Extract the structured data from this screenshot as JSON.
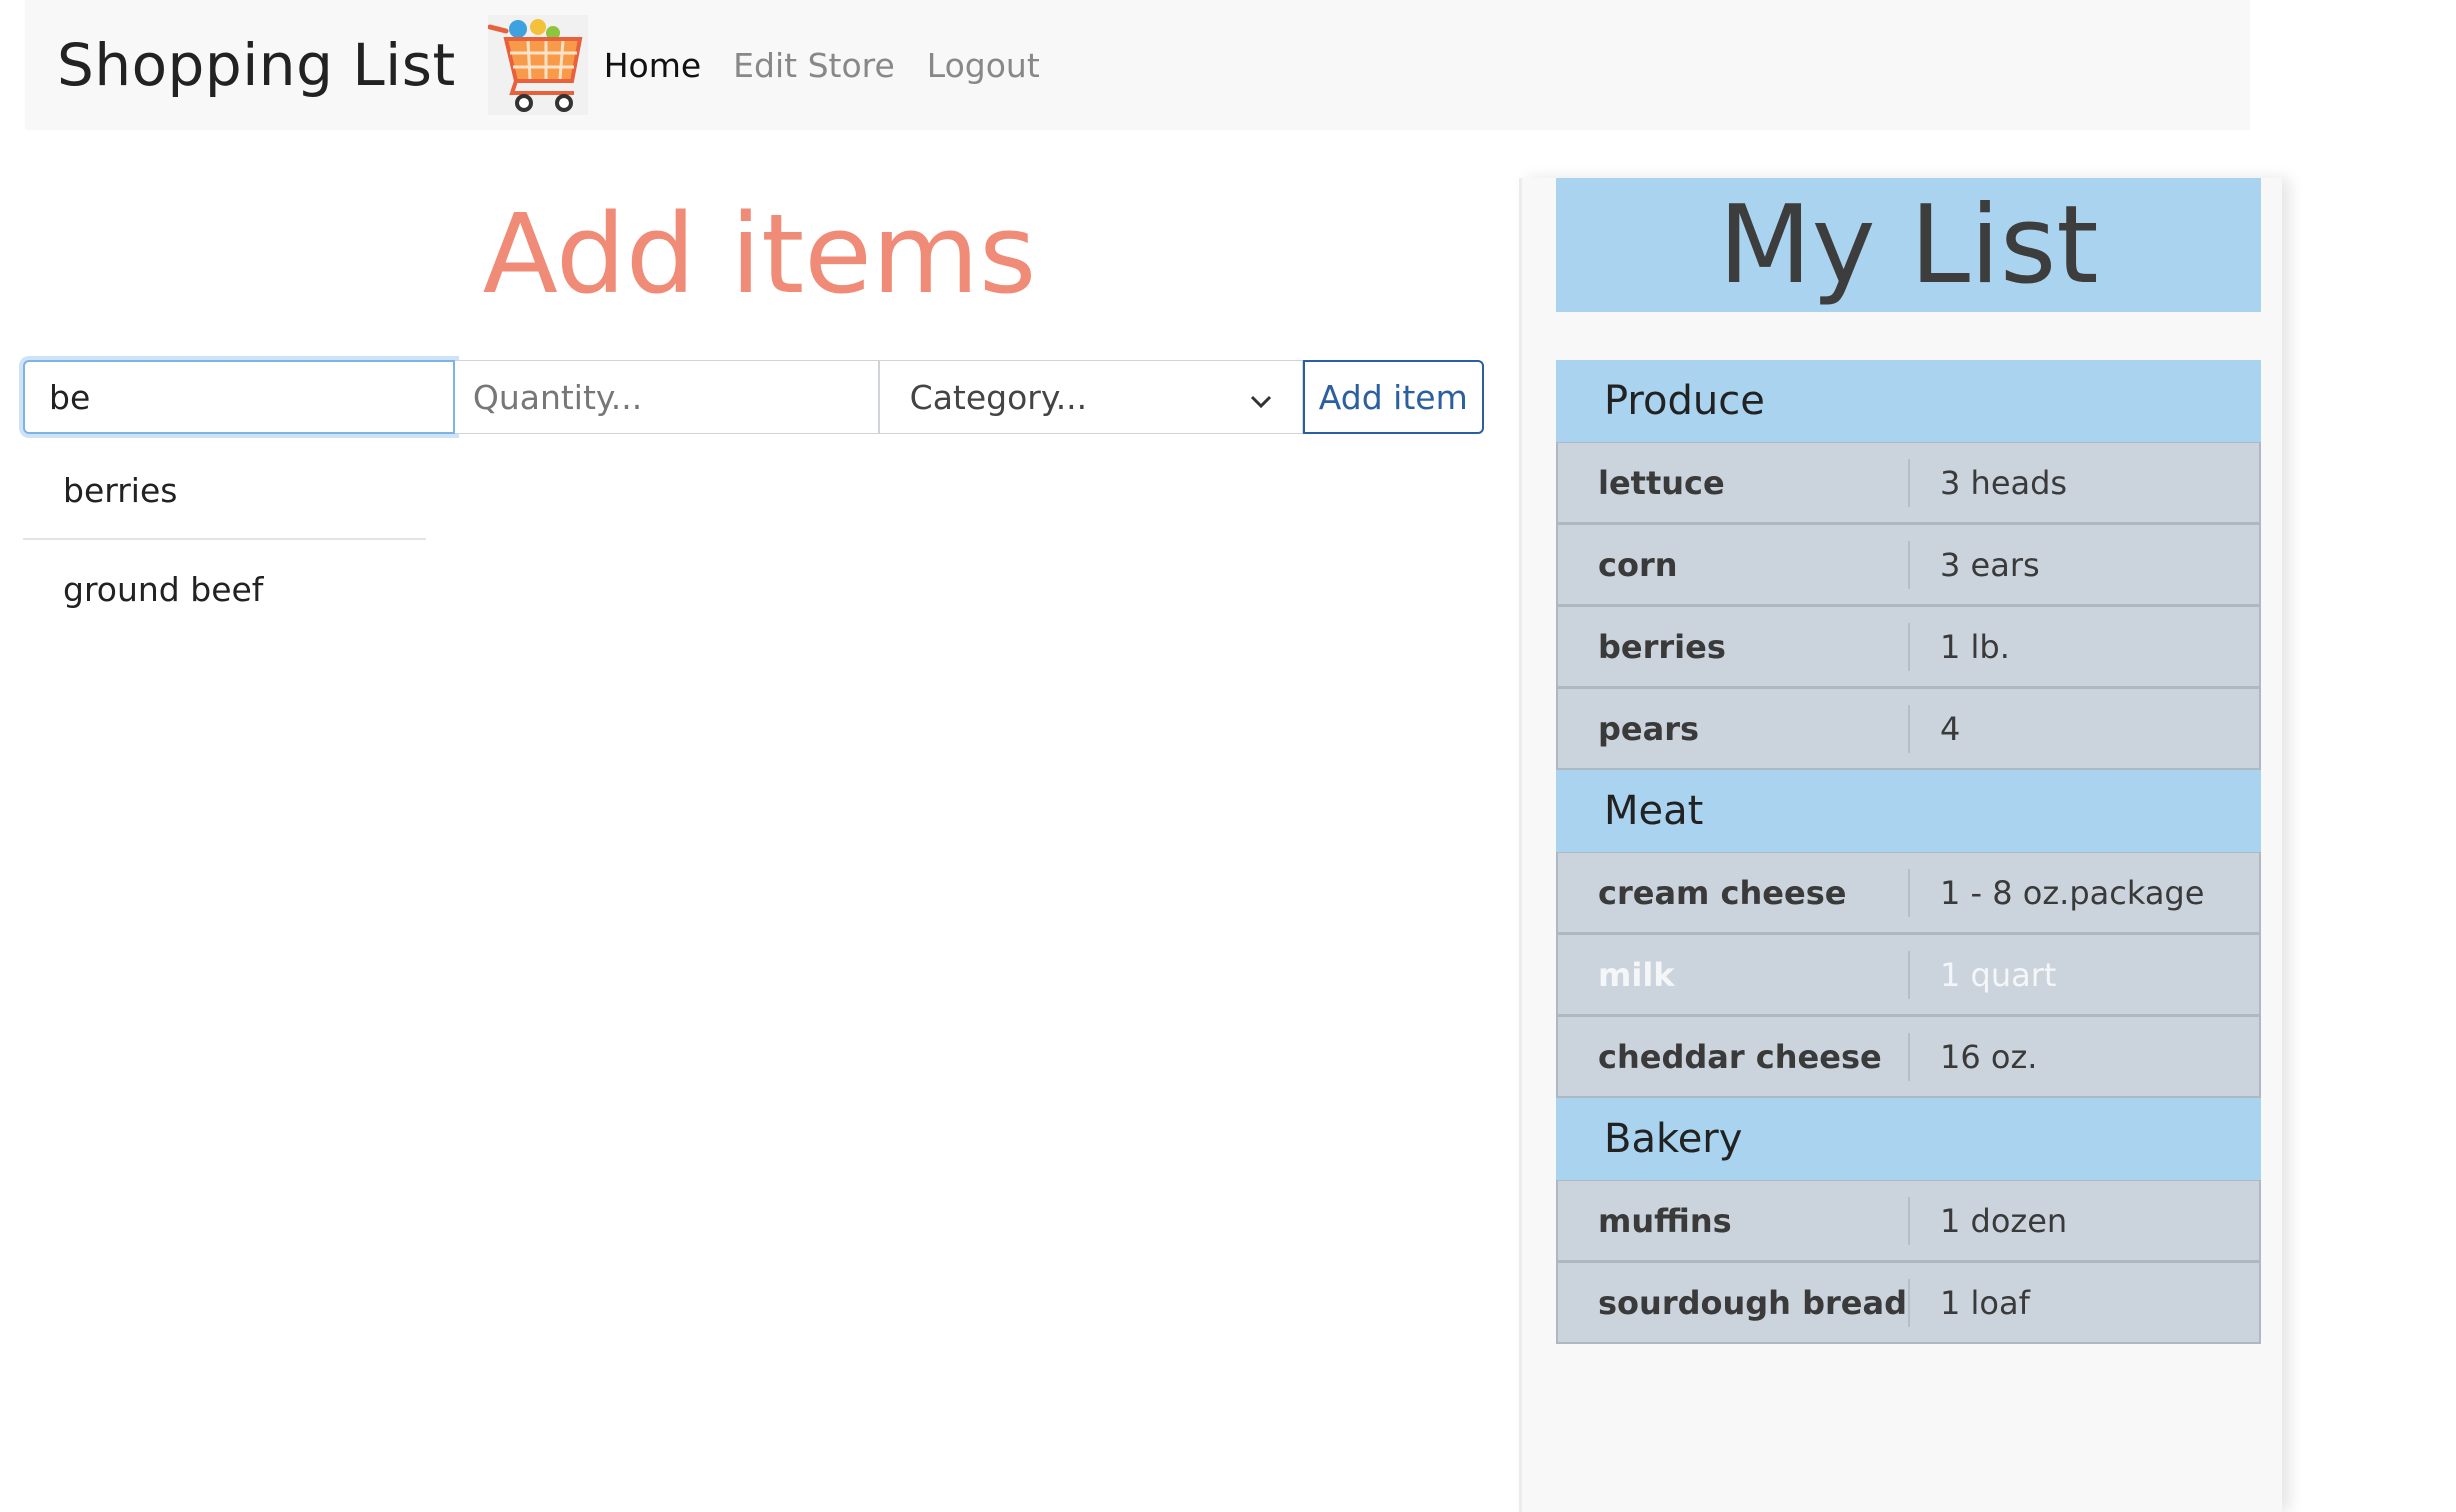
{
  "navbar": {
    "brand": "Shopping List",
    "logo_icon": "shopping-cart-icon",
    "links": [
      {
        "label": "Home",
        "active": true
      },
      {
        "label": "Edit Store",
        "active": false
      },
      {
        "label": "Logout",
        "active": false
      }
    ]
  },
  "add_panel": {
    "title": "Add items",
    "item_input_value": "be",
    "quantity_placeholder": "Quantity...",
    "category_selected": "Category...",
    "add_button_label": "Add item",
    "suggestions": [
      "berries",
      "ground beef"
    ]
  },
  "list_panel": {
    "title": "My List",
    "categories": [
      {
        "name": "Produce",
        "items": [
          {
            "name": "lettuce",
            "qty": "3 heads",
            "checked": false
          },
          {
            "name": "corn",
            "qty": "3 ears",
            "checked": false
          },
          {
            "name": "berries",
            "qty": "1 lb.",
            "checked": false
          },
          {
            "name": "pears",
            "qty": "4",
            "checked": false
          }
        ]
      },
      {
        "name": "Meat",
        "items": [
          {
            "name": "cream cheese",
            "qty": "1 - 8 oz.package",
            "checked": false
          },
          {
            "name": "milk",
            "qty": "1 quart",
            "checked": true
          },
          {
            "name": "cheddar cheese",
            "qty": "16 oz.",
            "checked": false
          }
        ]
      },
      {
        "name": "Bakery",
        "items": [
          {
            "name": "muffins",
            "qty": "1 dozen",
            "checked": false
          },
          {
            "name": "sourdough bread",
            "qty": "1 loaf",
            "checked": false
          }
        ]
      }
    ]
  },
  "colors": {
    "accent_title": "#ef8b76",
    "list_header": "#a9d3ee",
    "item_row": "#cbd4dd",
    "button": "#2b5fa0"
  }
}
